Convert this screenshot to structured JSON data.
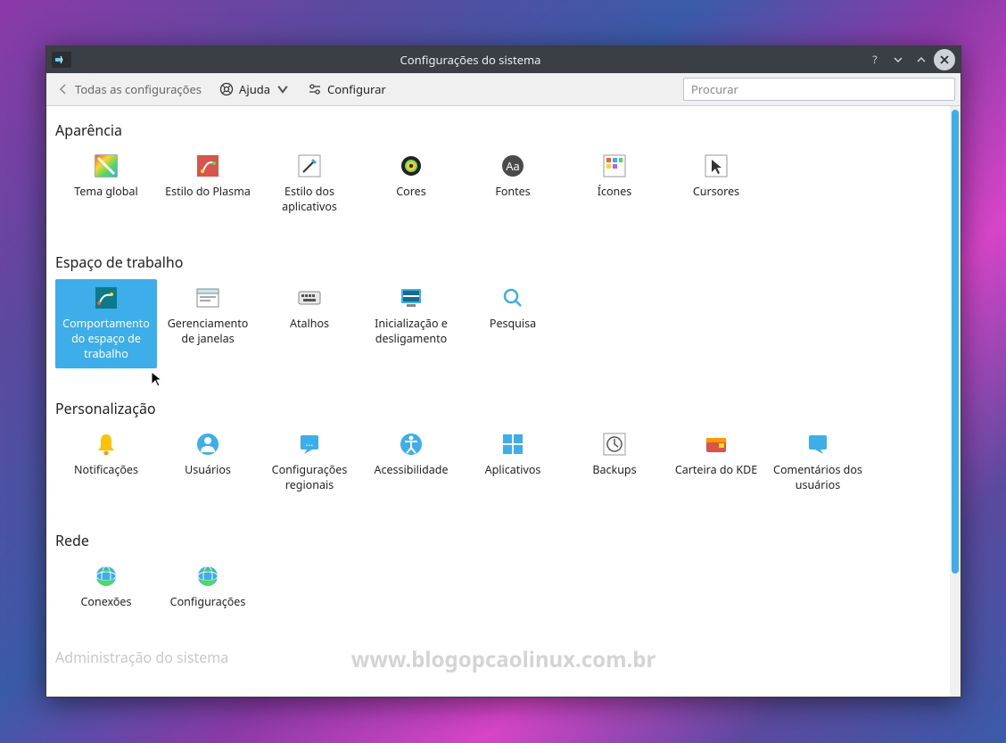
{
  "window": {
    "title": "Configurações do sistema"
  },
  "toolbar": {
    "back_label": "Todas as configurações",
    "help_label": "Ajuda",
    "configure_label": "Configurar",
    "search_placeholder": "Procurar"
  },
  "sections": {
    "appearance": {
      "title": "Aparência",
      "items": [
        {
          "label": "Tema global"
        },
        {
          "label": "Estilo do Plasma"
        },
        {
          "label": "Estilo dos aplicativos"
        },
        {
          "label": "Cores"
        },
        {
          "label": "Fontes"
        },
        {
          "label": "Ícones"
        },
        {
          "label": "Cursores"
        }
      ]
    },
    "workspace": {
      "title": "Espaço de trabalho",
      "items": [
        {
          "label": "Comportamento do espaço de trabalho"
        },
        {
          "label": "Gerenciamento de janelas"
        },
        {
          "label": "Atalhos"
        },
        {
          "label": "Inicialização e desligamento"
        },
        {
          "label": "Pesquisa"
        }
      ]
    },
    "personalization": {
      "title": "Personalização",
      "items": [
        {
          "label": "Notificações"
        },
        {
          "label": "Usuários"
        },
        {
          "label": "Configurações regionais"
        },
        {
          "label": "Acessibilidade"
        },
        {
          "label": "Aplicativos"
        },
        {
          "label": "Backups"
        },
        {
          "label": "Carteira do KDE"
        },
        {
          "label": "Comentários dos usuários"
        }
      ]
    },
    "network": {
      "title": "Rede",
      "items": [
        {
          "label": "Conexões"
        },
        {
          "label": "Configurações"
        }
      ]
    },
    "sysadmin": {
      "title": "Administração do sistema"
    }
  },
  "watermark": "www.blogopcaolinux.com.br"
}
